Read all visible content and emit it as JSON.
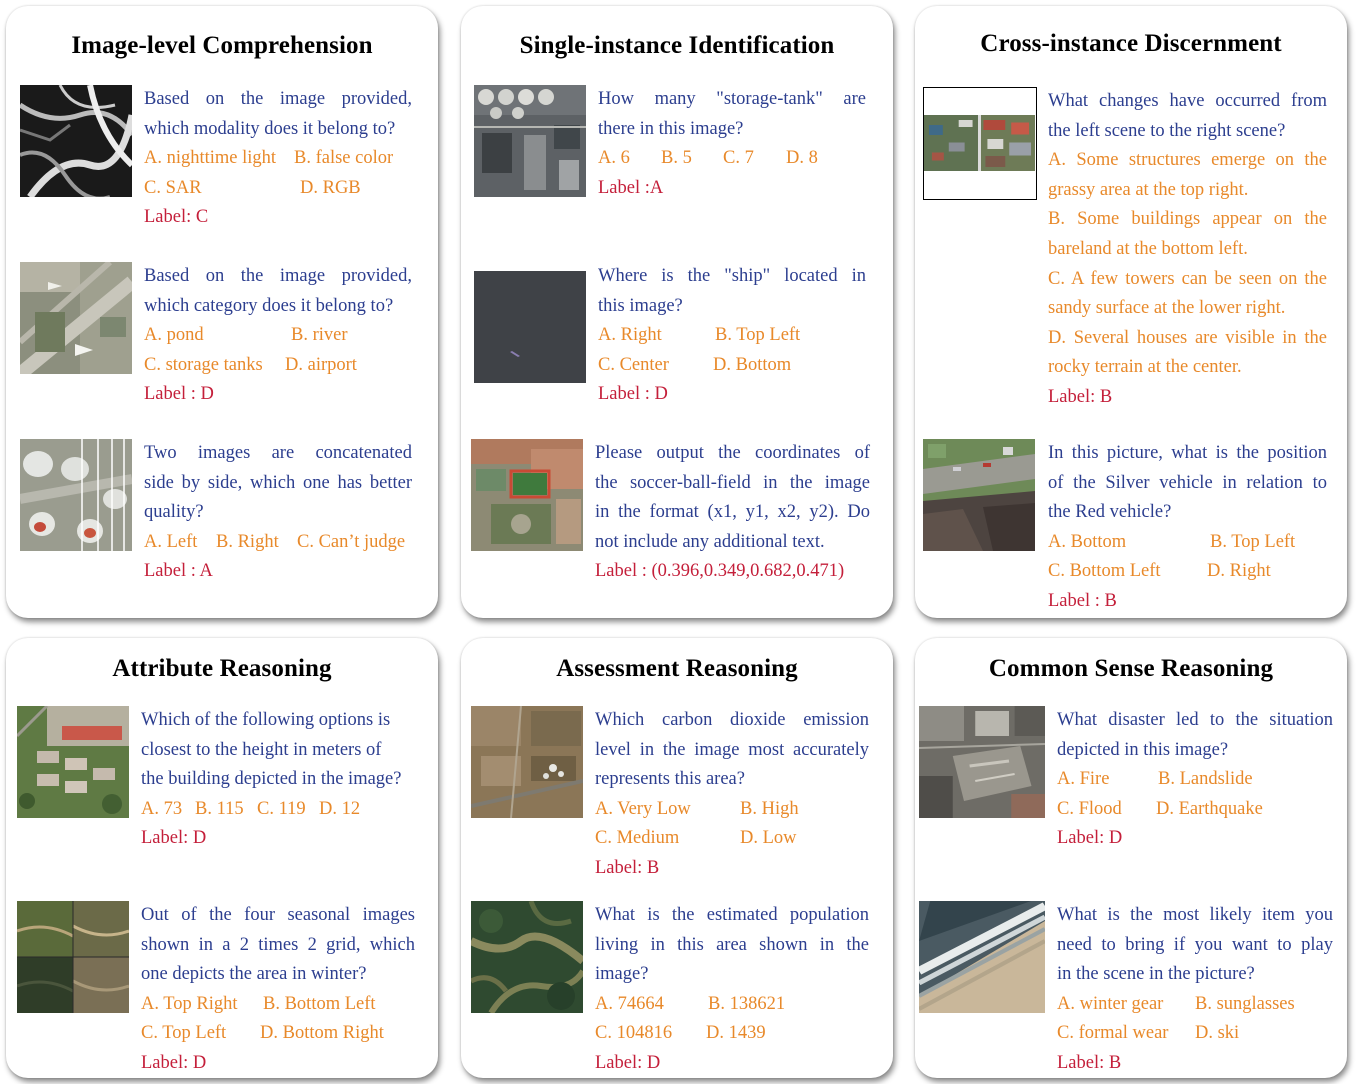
{
  "panels": [
    {
      "title": "Image-level Comprehension",
      "items": [
        {
          "q": [
            "Based on the image provided,",
            "which modality does it belong to?"
          ],
          "opts": [
            [
              "A. nighttime light",
              "B. false color"
            ],
            [
              "C. SAR",
              "D. RGB"
            ]
          ],
          "label": "Label: C"
        },
        {
          "q": [
            "Based on the image provided,",
            "which category does it belong to?"
          ],
          "opts": [
            [
              "A. pond",
              "B. river"
            ],
            [
              "C. storage tanks",
              "D. airport"
            ]
          ],
          "label": "Label : D"
        },
        {
          "q": [
            "Two images are concatenated",
            "side by side, which one has better",
            "quality?"
          ],
          "opts": [
            [
              "A. Left",
              "B. Right",
              "C. Can’t judge"
            ]
          ],
          "label": "Label : A"
        }
      ]
    },
    {
      "title": "Single-instance Identification",
      "items": [
        {
          "q": [
            "How many \"storage-tank\" are",
            "there in this image?"
          ],
          "opts": [
            [
              "A. 6",
              "B. 5",
              "C. 7",
              "D. 8"
            ]
          ],
          "label": "Label :A"
        },
        {
          "q": [
            "Where is the \"ship\" located in",
            "this image?"
          ],
          "opts": [
            [
              "A. Right",
              "B. Top Left"
            ],
            [
              "C. Center",
              "D. Bottom"
            ]
          ],
          "label": "Label : D"
        },
        {
          "q": [
            "Please output the coordinates of",
            "the soccer-ball-field in the image",
            "in the format (x1, y1, x2, y2). Do",
            "not include any additional text."
          ],
          "opts": [],
          "label": "Label : (0.396,0.349,0.682,0.471)"
        }
      ]
    },
    {
      "title": "Cross-instance Discernment",
      "items": [
        {
          "q": [
            "What changes have occurred from",
            "the left scene to the right scene?"
          ],
          "full": [
            "A. Some structures emerge on the",
            "grassy area at the top right.",
            "B. Some buildings appear on the",
            "bareland at the bottom left.",
            "C. A few towers can be seen on the",
            "sandy surface at the lower right.",
            "D. Several houses are visible in the",
            "rocky terrain at the center."
          ],
          "opts": [],
          "label": "Label: B"
        },
        {
          "q": [
            "In this picture, what is the position",
            "of the Silver vehicle in relation to",
            "the Red vehicle?"
          ],
          "opts": [
            [
              "A. Bottom",
              "B. Top Left"
            ],
            [
              "C. Bottom Left",
              "D. Right"
            ]
          ],
          "label": "Label : B"
        }
      ]
    },
    {
      "title": "Attribute Reasoning",
      "items": [
        {
          "q": [
            "Which of the following options is",
            "closest to the height in meters of",
            "the building depicted in the image?"
          ],
          "opts": [
            [
              "A. 73",
              "B. 115",
              "C. 119",
              "D. 12"
            ]
          ],
          "label": "Label: D"
        },
        {
          "q": [
            "Out of the four seasonal images",
            "shown in a 2 times 2 grid, which",
            "one depicts the area in winter?"
          ],
          "opts": [
            [
              "A. Top Right",
              "B. Bottom Left"
            ],
            [
              "C. Top Left",
              "D. Bottom Right"
            ]
          ],
          "label": "Label: D"
        }
      ]
    },
    {
      "title": "Assessment Reasoning",
      "items": [
        {
          "q": [
            "Which carbon dioxide emission",
            "level in the image most accurately",
            "represents this area?"
          ],
          "opts": [
            [
              "A. Very Low",
              "B. High"
            ],
            [
              "C. Medium",
              "D. Low"
            ]
          ],
          "label": "Label: B"
        },
        {
          "q": [
            "What is the estimated population",
            "living in this area shown in the",
            "image?"
          ],
          "opts": [
            [
              "A. 74664",
              "B. 138621"
            ],
            [
              "C. 104816",
              "D. 1439"
            ]
          ],
          "label": "Label: D"
        }
      ]
    },
    {
      "title": "Common Sense Reasoning",
      "items": [
        {
          "q": [
            "What disaster led to the situation",
            "depicted in this image?"
          ],
          "opts": [
            [
              "A. Fire",
              "B. Landslide"
            ],
            [
              "C. Flood",
              "D. Earthquake"
            ]
          ],
          "label": "Label: D"
        },
        {
          "q": [
            "What is the most likely item you",
            "need to bring if you want to play",
            "in the scene in the picture?"
          ],
          "opts": [
            [
              "A. winter gear",
              "B. sunglasses"
            ],
            [
              "C. formal wear",
              "D. ski"
            ]
          ],
          "label": "Label: B"
        }
      ]
    }
  ],
  "colors": {
    "question": "#2c3e8f",
    "option": "#e8892a",
    "label": "#c41f3a"
  }
}
